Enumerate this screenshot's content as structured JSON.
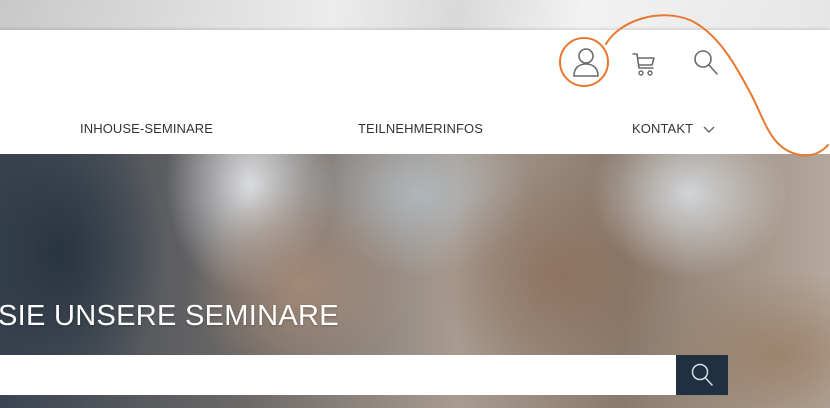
{
  "header": {
    "icons": {
      "account": "user-icon",
      "cart": "cart-icon",
      "search": "search-icon"
    }
  },
  "nav": {
    "items": [
      {
        "label": "INHOUSE-SEMINARE"
      },
      {
        "label": "TEILNEHMERINFOS"
      },
      {
        "label": "KONTAKT"
      }
    ]
  },
  "hero": {
    "title": "SIE UNSERE SEMINARE",
    "search": {
      "placeholder": "",
      "value": ""
    }
  },
  "colors": {
    "annotation": "#e8782f",
    "nav_text": "#333333",
    "search_button": "#1f3140",
    "icon_stroke": "#6a6a6a"
  }
}
